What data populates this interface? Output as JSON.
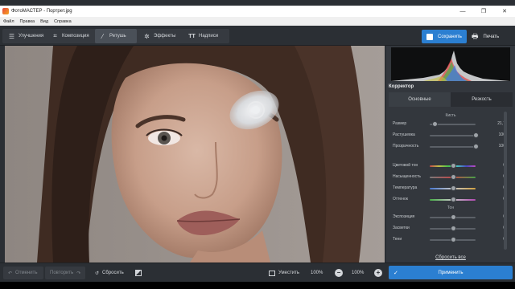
{
  "window": {
    "title": "ФотоМАСТЕР - Портрет.jpg",
    "controls": [
      "—",
      "❐",
      "✕"
    ]
  },
  "menu": [
    "Файл",
    "Правка",
    "Вид",
    "Справка"
  ],
  "toolbar": {
    "tabs": [
      {
        "label": "Улучшения",
        "icon": "sliders-icon"
      },
      {
        "label": "Композиция",
        "icon": "crop-icon"
      },
      {
        "label": "Ретушь",
        "icon": "brush-icon",
        "active": true
      },
      {
        "label": "Эффекты",
        "icon": "magic-wand-icon"
      },
      {
        "label": "Надписи",
        "icon": "text-icon"
      }
    ],
    "save_label": "Сохранить",
    "print_label": "Печать"
  },
  "panel": {
    "title": "Корректор",
    "subtabs": [
      "Основные",
      "Резкость"
    ],
    "brush_section": "Кисть",
    "brush_rows": [
      {
        "label": "Размер",
        "value": "21,7",
        "level": 0.12
      },
      {
        "label": "Растушевка",
        "value": "100",
        "level": 1.0
      },
      {
        "label": "Прозрачность",
        "value": "100",
        "level": 1.0
      }
    ],
    "color_rows": [
      {
        "label": "Цветовой тон",
        "value": "0",
        "gradient": "hue"
      },
      {
        "label": "Насыщенность",
        "value": "0",
        "gradient": "sat"
      },
      {
        "label": "Температура",
        "value": "0",
        "gradient": "temp"
      },
      {
        "label": "Оттенок",
        "value": "0",
        "gradient": "tint"
      }
    ],
    "tone_section": "Тон",
    "tone_rows": [
      {
        "label": "Экспозиция",
        "value": "0"
      },
      {
        "label": "Засветки",
        "value": "0"
      },
      {
        "label": "Тени",
        "value": "0"
      }
    ],
    "reset_all": "Сбросить все"
  },
  "bottom": {
    "undo_label": "Отменить",
    "redo_label": "Повторить",
    "reset_label": "Сбросить",
    "fit_label": "Уместить",
    "zoom_fit": "100%",
    "zoom_value": "100%",
    "apply_label": "Применить"
  },
  "colors": {
    "accent": "#2b7fd1",
    "background": "#2b2f34",
    "panel": "#33373d"
  }
}
